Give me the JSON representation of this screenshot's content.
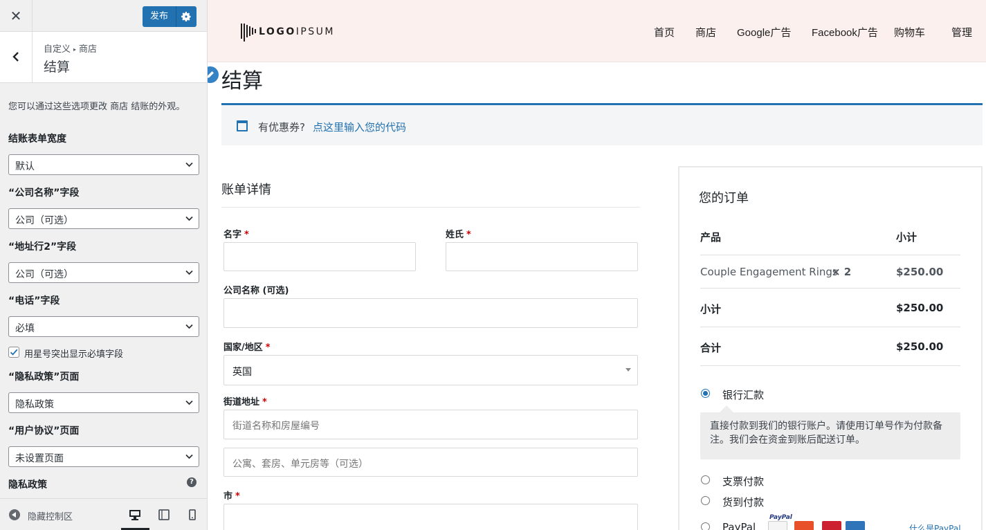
{
  "controls": {
    "close_label": "✕",
    "publish_label": "发布",
    "breadcrumb": {
      "root": "自定义",
      "arrow": "▸",
      "section": "商店"
    },
    "section_title": "结算",
    "description": "您可以通过这些选项更改 商店 结账的外观。",
    "fields": [
      {
        "label": "结账表单宽度",
        "value": "默认"
      },
      {
        "label": "“公司名称”字段",
        "value": "公司（可选）"
      },
      {
        "label": "“地址行2”字段",
        "value": "公司（可选）"
      },
      {
        "label": "“电话”字段",
        "value": "必填"
      }
    ],
    "highlight_required_label": "用星号突出显示必填字段",
    "highlight_required_checked": true,
    "privacy_page": {
      "label": "“隐私政策”页面",
      "value": "隐私政策"
    },
    "terms_page": {
      "label": "“用户协议”页面",
      "value": "未设置页面"
    },
    "privacy_policy_heading": "隐私政策",
    "help_label": "?",
    "hide_controls_label": "隐藏控制区",
    "preview_device_selected": "desktop"
  },
  "site": {
    "logo_text_bold": "LOGO",
    "logo_text_light": "IPSUM",
    "nav": [
      "首页",
      "商店",
      "Google广告",
      "Facebook广告",
      "购物车",
      "管理"
    ],
    "page_title": "结算",
    "coupon": {
      "text": "有优惠券?",
      "link": "点这里输入您的代码"
    },
    "billing": {
      "heading": "账单详情",
      "required_mark": "*",
      "first_name_label": "名字",
      "last_name_label": "姓氏",
      "company_label": "公司名称 (可选)",
      "country_label": "国家/地区",
      "country_value": "英国",
      "street_label": "街道地址",
      "street_placeholder": "街道名称和房屋编号",
      "street2_placeholder": "公寓、套房、单元房等（可选）",
      "city_label": "市"
    },
    "order": {
      "heading": "您的订单",
      "col_product": "产品",
      "col_subtotal": "小计",
      "item_name": "Couple Engagement Rings",
      "item_qty": "× 2",
      "item_total": "$250.00",
      "subtotal_label": "小计",
      "subtotal_value": "$250.00",
      "total_label": "合计",
      "total_value": "$250.00",
      "payment_methods": [
        "银行汇款",
        "支票付款",
        "货到付款",
        "PayPal"
      ],
      "selected_payment": "银行汇款",
      "bank_description": "直接付款到我们的银行账户。请使用订单号作为付款备注。我们会在资金到账后配送订单。",
      "paypal_logo_text": "PayPal",
      "paypal_link": "什么是PayPal"
    }
  },
  "colors": {
    "accent": "#2271b1",
    "header_bg": "#fcf0ee",
    "panel_bg": "#f0f0f1",
    "required": "#cc0000"
  }
}
